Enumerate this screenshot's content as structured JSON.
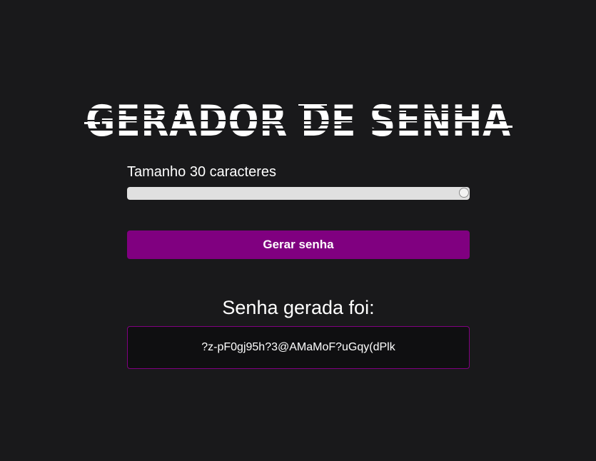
{
  "header": {
    "logo_text": "GERADOR DE SENHA"
  },
  "length": {
    "label": "Tamanho 30 caracteres",
    "value": 30,
    "slider_fraction": 1.0
  },
  "actions": {
    "generate_label": "Gerar senha"
  },
  "result": {
    "title": "Senha gerada foi:",
    "password": "?z-pF0gj95h?3@AMaMoF?uGqy(dPlk"
  },
  "colors": {
    "background": "#19191b",
    "accent": "#800080",
    "slider_track": "#e0e0e0",
    "text": "#ffffff"
  }
}
